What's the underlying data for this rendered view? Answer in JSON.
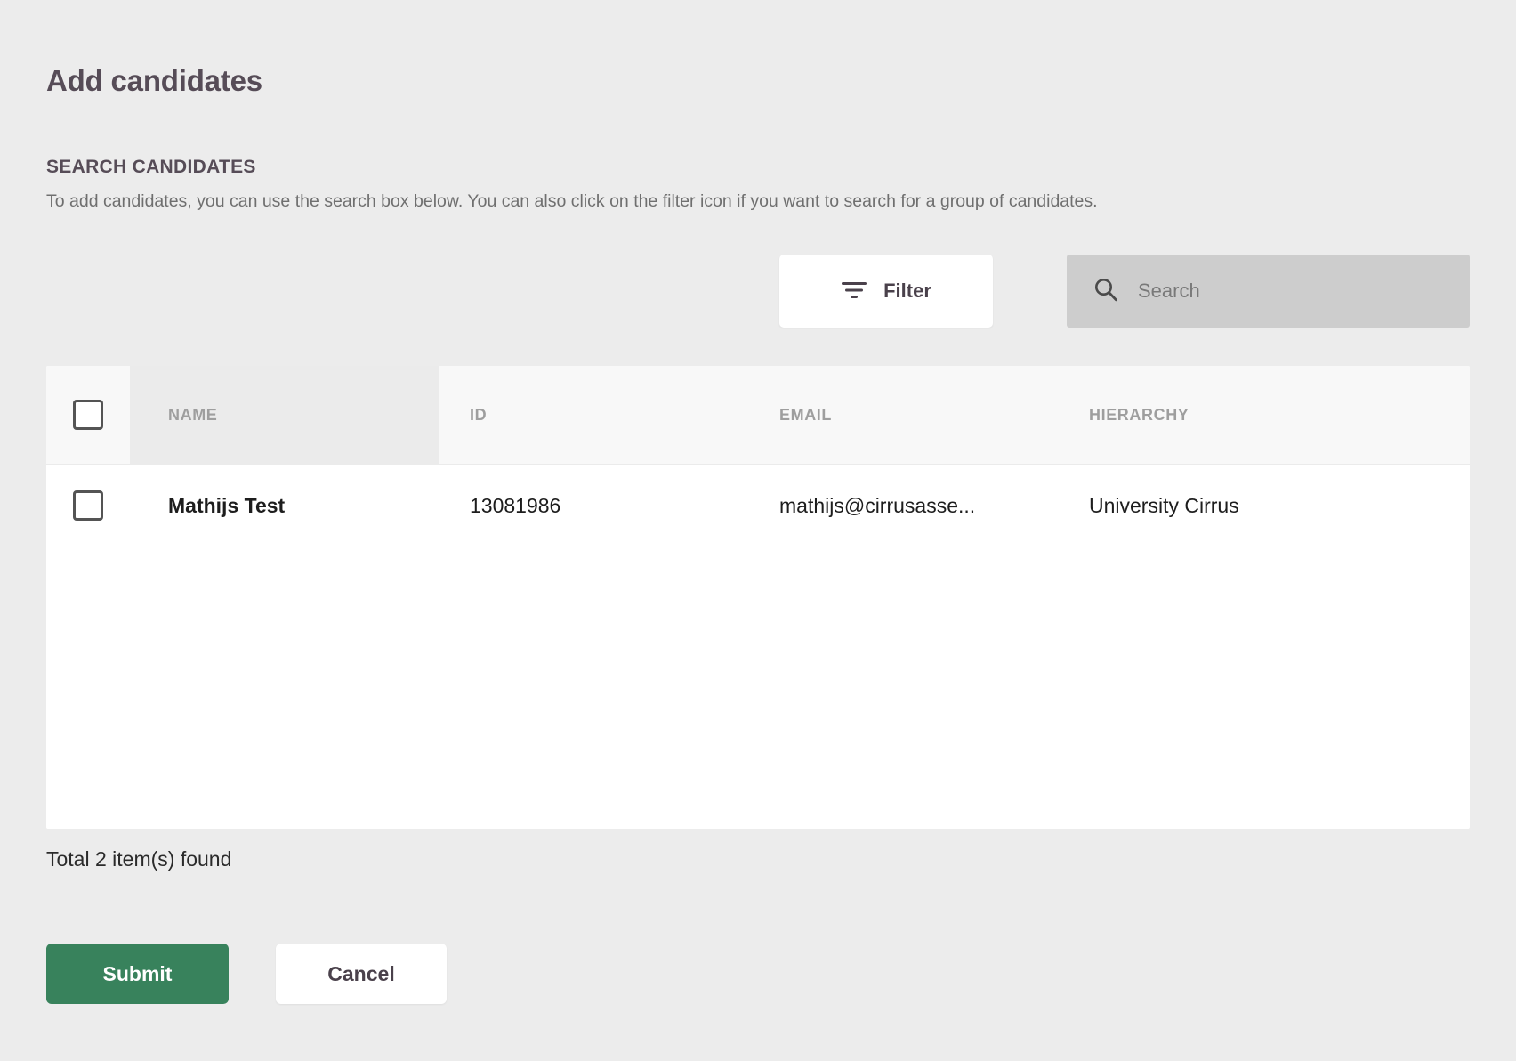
{
  "header": {
    "title": "Add candidates"
  },
  "search_section": {
    "label": "SEARCH CANDIDATES",
    "description": "To add candidates, you can use the search box below. You can also click on the filter icon if you want to search for a group of candidates."
  },
  "toolbar": {
    "filter_label": "Filter",
    "filter_icon": "filter-icon",
    "search_icon": "search-icon",
    "search_placeholder": "Search",
    "search_value": ""
  },
  "table": {
    "select_all_checked": false,
    "columns": [
      {
        "key": "name",
        "label": "NAME"
      },
      {
        "key": "id",
        "label": "ID"
      },
      {
        "key": "email",
        "label": "EMAIL"
      },
      {
        "key": "hierarchy",
        "label": "HIERARCHY"
      }
    ],
    "rows": [
      {
        "checked": false,
        "name": "Mathijs Test",
        "id": "13081986",
        "email": "mathijs@cirrusasse...",
        "hierarchy": "University Cirrus"
      }
    ]
  },
  "footer": {
    "total_text": "Total 2 item(s) found",
    "submit_label": "Submit",
    "cancel_label": "Cancel"
  },
  "colors": {
    "page_background": "#ececec",
    "title_text": "#564c57",
    "muted_text": "#6f6f6f",
    "header_text": "#9e9e9e",
    "submit_green": "#38825c",
    "search_background": "#cdcdcd",
    "table_background": "#ffffff",
    "name_column_background": "#ebebeb"
  }
}
